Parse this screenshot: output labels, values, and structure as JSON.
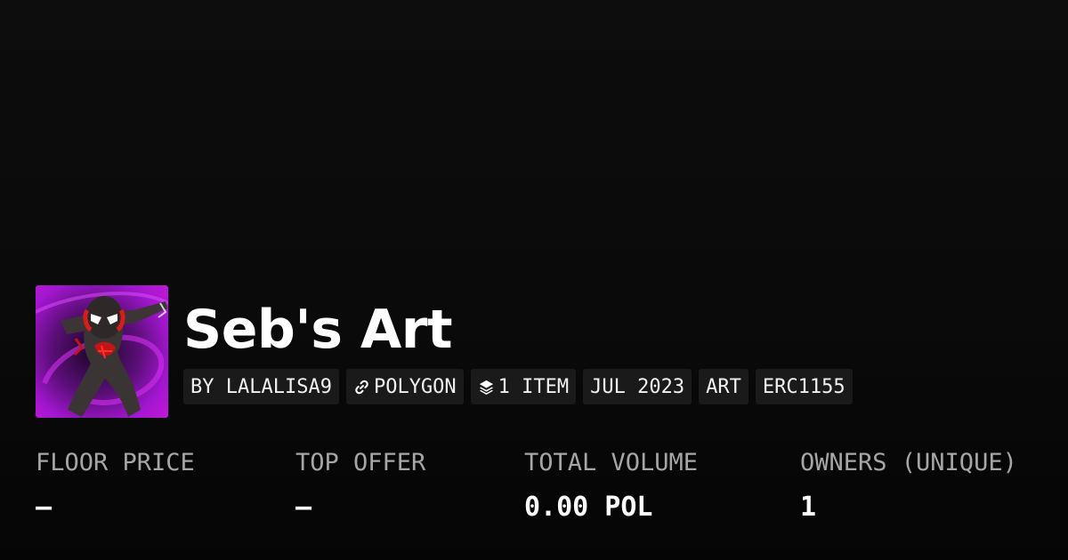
{
  "collection": {
    "name": "Seb's Art",
    "avatar_alt": "collection-avatar"
  },
  "tags": [
    {
      "label": "BY LALALISA9",
      "icon": null
    },
    {
      "label": "POLYGON",
      "icon": "chain-link-icon"
    },
    {
      "label": "1 ITEM",
      "icon": "layers-icon"
    },
    {
      "label": "JUL 2023",
      "icon": null
    },
    {
      "label": "ART",
      "icon": null
    },
    {
      "label": "ERC1155",
      "icon": null
    }
  ],
  "stats": [
    {
      "label": "FLOOR PRICE",
      "value": "–"
    },
    {
      "label": "TOP OFFER",
      "value": "–"
    },
    {
      "label": "TOTAL VOLUME",
      "value": "0.00 POL"
    },
    {
      "label": "OWNERS (UNIQUE)",
      "value": "1"
    }
  ],
  "colors": {
    "background": "#0a0a0a",
    "tag_background": "#1a1a1a",
    "label_gray": "#a6a6a6",
    "text": "#ffffff"
  }
}
